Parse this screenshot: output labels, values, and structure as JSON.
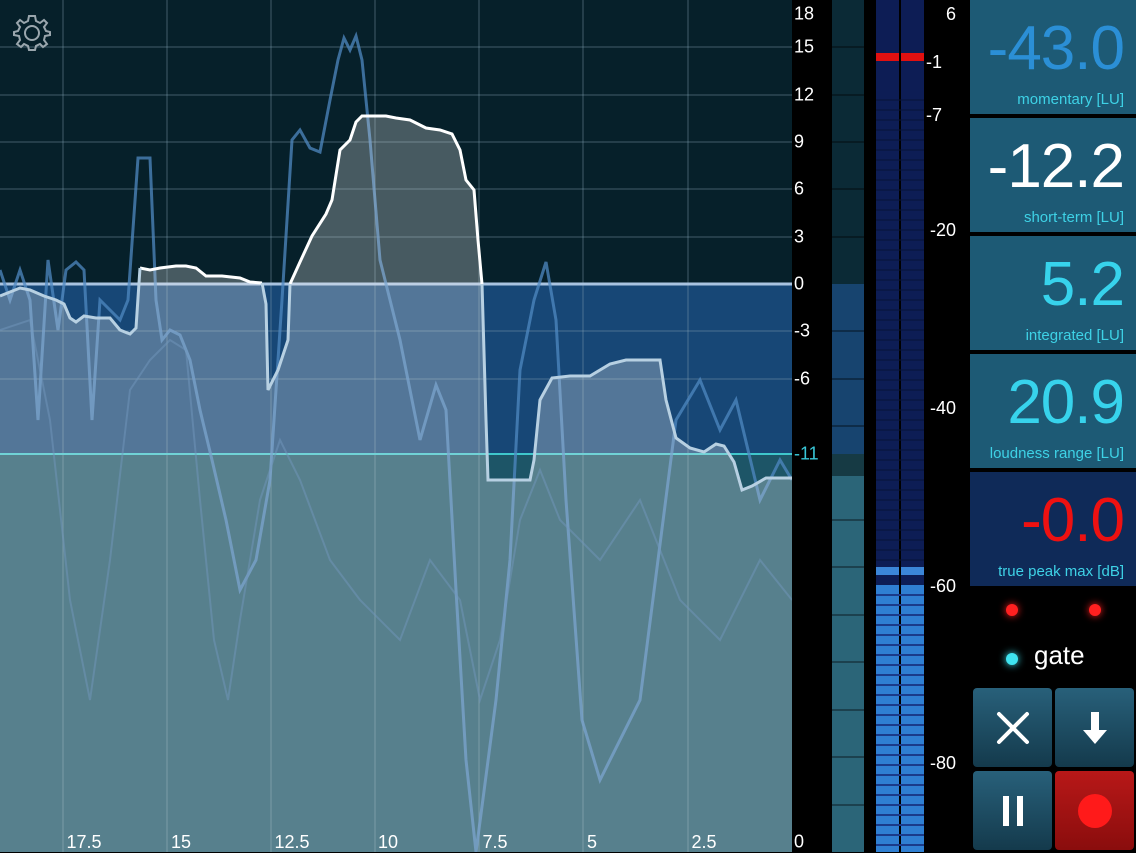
{
  "graph": {
    "y_ticks": [
      "18",
      "15",
      "12",
      "9",
      "6",
      "3",
      "0",
      "-3",
      "-6",
      "-11",
      "0"
    ],
    "x_ticks": [
      "17.5",
      "15",
      "12.5",
      "10",
      "7.5",
      "5",
      "2.5"
    ]
  },
  "meter": {
    "ticks": [
      "6",
      "-1",
      "-7",
      "-20",
      "-40",
      "-60",
      "-80"
    ]
  },
  "readouts": {
    "momentary": {
      "value": "-43.0",
      "label": "momentary [LU]",
      "color": "#2b8fd6"
    },
    "short_term": {
      "value": "-12.2",
      "label": "short-term [LU]",
      "color": "#ffffff"
    },
    "integrated": {
      "value": "5.2",
      "label": "integrated [LU]",
      "color": "#37d3ec"
    },
    "loudness_range": {
      "value": "20.9",
      "label": "loudness range [LU]",
      "color": "#37d3ec"
    },
    "true_peak": {
      "value": "-0.0",
      "label": "true peak max [dB]",
      "color": "#ee1111"
    }
  },
  "gate_label": "gate",
  "icons": {
    "settings": "gear-icon",
    "reset": "close-icon",
    "export": "arrow-down-icon",
    "pause": "pause-icon",
    "record": "record-icon"
  },
  "colors": {
    "accent": "#39c7d8",
    "peak": "#ee1111",
    "panel": "#1d5a75"
  }
}
